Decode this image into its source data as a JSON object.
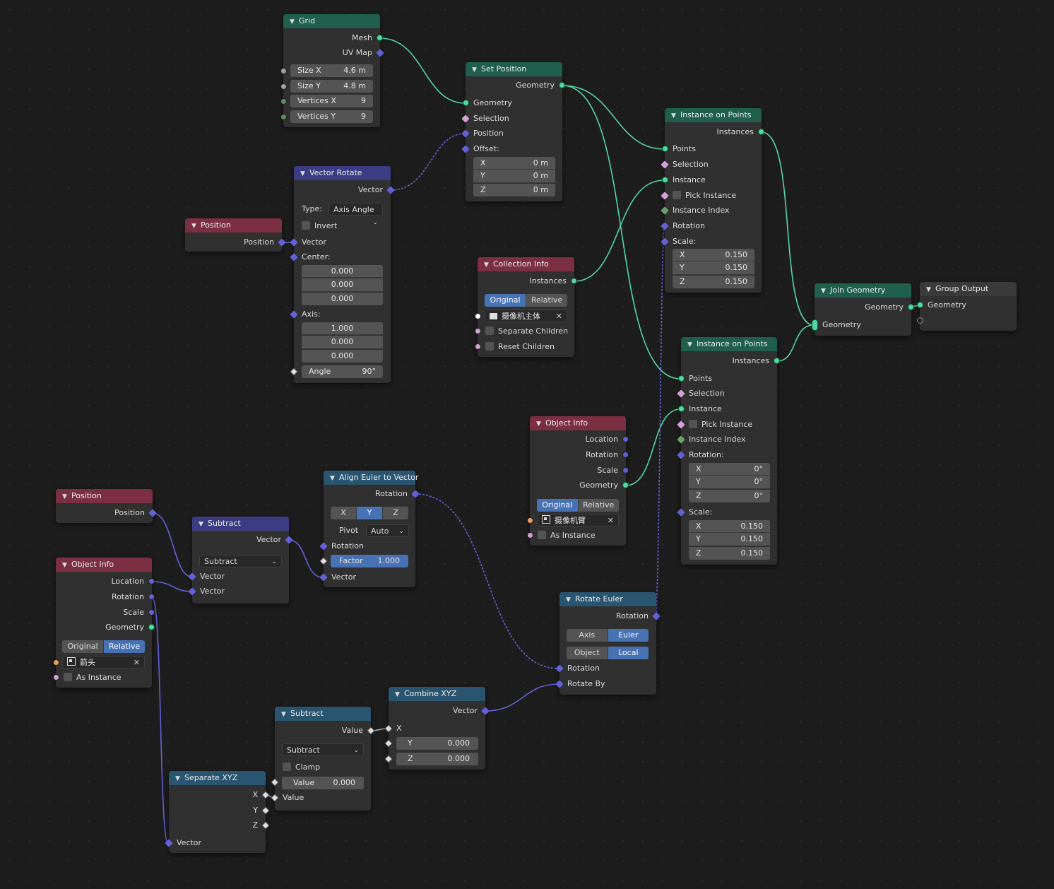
{
  "colors": {
    "geometry": "#55d6a4",
    "vector": "#6361d6",
    "float": "#a1a1a1",
    "integer": "#5d8f5d",
    "object": "#ee9f5b",
    "boolean": "#d2a0d6",
    "selected_toggle": "#4772b3"
  },
  "grid": {
    "title": "Grid",
    "out_mesh": "Mesh",
    "out_uv": "UV Map",
    "size_x_label": "Size X",
    "size_x": "4.6 m",
    "size_y_label": "Size Y",
    "size_y": "4.8 m",
    "vx_label": "Vertices X",
    "vx": "9",
    "vy_label": "Vertices Y",
    "vy": "9"
  },
  "set_position": {
    "title": "Set Position",
    "out_geometry": "Geometry",
    "in_geometry": "Geometry",
    "in_selection": "Selection",
    "in_position": "Position",
    "in_offset": "Offset:",
    "x_label": "X",
    "x": "0 m",
    "y_label": "Y",
    "y": "0 m",
    "z_label": "Z",
    "z": "0 m"
  },
  "vector_rotate": {
    "title": "Vector Rotate",
    "out_vector": "Vector",
    "type_label": "Type:",
    "type_value": "Axis Angle",
    "invert": "Invert",
    "in_vector": "Vector",
    "center_label": "Center:",
    "c1": "0.000",
    "c2": "0.000",
    "c3": "0.000",
    "axis_label": "Axis:",
    "a1": "1.000",
    "a2": "0.000",
    "a3": "0.000",
    "angle_label": "Angle",
    "angle": "90°"
  },
  "position1": {
    "title": "Position",
    "out": "Position"
  },
  "collection_info": {
    "title": "Collection Info",
    "out": "Instances",
    "opt_original": "Original",
    "opt_relative": "Relative",
    "collection": "摄像机主体",
    "separate": "Separate Children",
    "reset": "Reset Children"
  },
  "iop1": {
    "title": "Instance on Points",
    "out": "Instances",
    "points": "Points",
    "selection": "Selection",
    "instance": "Instance",
    "pick": "Pick Instance",
    "index": "Instance Index",
    "rotation": "Rotation",
    "scale_label": "Scale:",
    "sx_label": "X",
    "sx": "0.150",
    "sy_label": "Y",
    "sy": "0.150",
    "sz_label": "Z",
    "sz": "0.150"
  },
  "join": {
    "title": "Join Geometry",
    "out": "Geometry",
    "in": "Geometry"
  },
  "group_output": {
    "title": "Group Output",
    "in": "Geometry"
  },
  "iop2": {
    "title": "Instance on Points",
    "out": "Instances",
    "points": "Points",
    "selection": "Selection",
    "instance": "Instance",
    "pick": "Pick Instance",
    "index": "Instance Index",
    "rot_label": "Rotation:",
    "rx_label": "X",
    "rx": "0°",
    "ry_label": "Y",
    "ry": "0°",
    "rz_label": "Z",
    "rz": "0°",
    "scale_label": "Scale:",
    "sx_label": "X",
    "sx": "0.150",
    "sy_label": "Y",
    "sy": "0.150",
    "sz_label": "Z",
    "sz": "0.150"
  },
  "object_info1": {
    "title": "Object Info",
    "location": "Location",
    "rotation": "Rotation",
    "scale": "Scale",
    "geometry": "Geometry",
    "opt_original": "Original",
    "opt_relative": "Relative",
    "object": "摄像机臂",
    "as_instance": "As Instance"
  },
  "align_euler": {
    "title": "Align Euler to Vector",
    "out": "Rotation",
    "ax_x": "X",
    "ax_y": "Y",
    "ax_z": "Z",
    "pivot_label": "Pivot",
    "pivot_value": "Auto",
    "in_rotation": "Rotation",
    "factor_label": "Factor",
    "factor": "1.000",
    "in_vector": "Vector"
  },
  "position2": {
    "title": "Position",
    "out": "Position"
  },
  "subtract_vec": {
    "title": "Subtract",
    "out": "Vector",
    "op": "Subtract",
    "in1": "Vector",
    "in2": "Vector"
  },
  "object_info2": {
    "title": "Object Info",
    "location": "Location",
    "rotation": "Rotation",
    "scale": "Scale",
    "geometry": "Geometry",
    "opt_original": "Original",
    "opt_relative": "Relative",
    "object": "箭头",
    "as_instance": "As Instance"
  },
  "rotate_euler": {
    "title": "Rotate Euler",
    "out": "Rotation",
    "opt_axis": "Axis Angle",
    "opt_euler": "Euler",
    "opt_object": "Object",
    "opt_local": "Local",
    "in_rotation": "Rotation",
    "in_rotate_by": "Rotate By"
  },
  "combine_xyz": {
    "title": "Combine XYZ",
    "out": "Vector",
    "in_x": "X",
    "y_label": "Y",
    "y": "0.000",
    "z_label": "Z",
    "z": "0.000"
  },
  "subtract_math": {
    "title": "Subtract",
    "out": "Value",
    "op": "Subtract",
    "clamp": "Clamp",
    "value_label": "Value",
    "value": "0.000",
    "in_value": "Value"
  },
  "separate_xyz": {
    "title": "Separate XYZ",
    "out_x": "X",
    "out_y": "Y",
    "out_z": "Z",
    "in_vector": "Vector"
  }
}
